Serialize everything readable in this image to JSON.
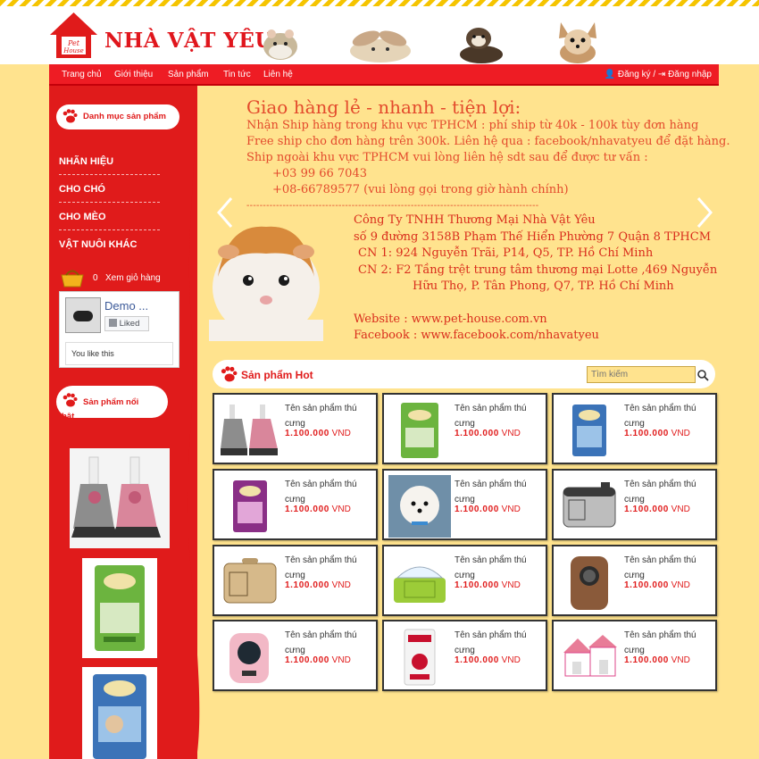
{
  "brand": {
    "logo_small_1": "Pet",
    "logo_small_2": "House",
    "name": "NHÀ VẬT YÊU"
  },
  "nav": {
    "items": [
      "Trang chủ",
      "Giới thiệu",
      "Sản phẩm",
      "Tin tức",
      "Liên hệ"
    ],
    "auth": "Đăng ký / ⇥ Đăng nhập"
  },
  "sidebar": {
    "category_title": "Danh mục sản phẩm",
    "menu": [
      "NHÃN HIỆU",
      "CHO CHÓ",
      "CHO MÈO",
      "VẬT NUÔI KHÁC"
    ],
    "cart_count": "0",
    "cart_label": "Xem giỏ hàng",
    "fb_name": "Demo ...",
    "fb_liked": "Liked",
    "fb_you_like": "You like this",
    "featured_title": "Sản phẩm nổi bật"
  },
  "notice": {
    "title": "Giao hàng lẻ - nhanh - tiện lợi:",
    "line1": "Nhận Ship hàng trong khu vực TPHCM : phí ship từ 40k - 100k tùy đơn hàng",
    "line2": "Free ship cho đơn hàng trên 300k. Liên hệ qua : facebook/nhavatyeu để đặt hàng.",
    "line3": "Ship ngoài khu vực TPHCM vui lòng liên hệ sdt sau để được tư vấn :",
    "phone1": "+03 99 66 7043",
    "phone2": "+08-66789577 (vui lòng gọi trong giờ hành chính)",
    "divider": "-----------------------------------------------------------------------------------------"
  },
  "company": {
    "name": "Công Ty TNHH Thương Mại Nhà Vật Yêu",
    "address": "số 9 đường 3158B Phạm Thế Hiển Phường 7 Quận 8 TPHCM",
    "branch1": "CN 1: 924 Nguyễn Trãi, P14, Q5, TP. Hồ Chí Minh",
    "branch2a": "CN 2: F2 Tầng trệt trung tâm thương mại Lotte ,469 Nguyễn",
    "branch2b": "Hữu Thọ, P. Tân Phong, Q7, TP. Hồ Chí Minh",
    "website": "Website : www.pet-house.com.vn",
    "facebook": "Facebook : www.facebook.com/nhavatyeu"
  },
  "hot": {
    "title": "Sản phẩm Hot",
    "search_placeholder": "Tìm kiếm"
  },
  "products": [
    {
      "name": "Tên sản phẩm thú cưng",
      "price": "1.100.000",
      "unit": "VND",
      "icon": "dress-icon"
    },
    {
      "name": "Tên sản phẩm thú cưng",
      "price": "1.100.000",
      "unit": "VND",
      "icon": "green-food-bag-icon"
    },
    {
      "name": "Tên sản phẩm thú cưng",
      "price": "1.100.000",
      "unit": "VND",
      "icon": "blue-food-bag-icon"
    },
    {
      "name": "Tên sản phẩm thú cưng",
      "price": "1.100.000",
      "unit": "VND",
      "icon": "purple-food-bag-icon"
    },
    {
      "name": "Tên sản phẩm thú cưng",
      "price": "1.100.000",
      "unit": "VND",
      "icon": "white-dog-icon"
    },
    {
      "name": "Tên sản phẩm thú cưng",
      "price": "1.100.000",
      "unit": "VND",
      "icon": "grey-carrier-icon"
    },
    {
      "name": "Tên sản phẩm thú cưng",
      "price": "1.100.000",
      "unit": "VND",
      "icon": "tan-carrier-icon"
    },
    {
      "name": "Tên sản phẩm thú cưng",
      "price": "1.100.000",
      "unit": "VND",
      "icon": "green-carrier-icon"
    },
    {
      "name": "Tên sản phẩm thú cưng",
      "price": "1.100.000",
      "unit": "VND",
      "icon": "brown-backpack-icon"
    },
    {
      "name": "Tên sản phẩm thú cưng",
      "price": "1.100.000",
      "unit": "VND",
      "icon": "pink-backpack-icon"
    },
    {
      "name": "Tên sản phẩm thú cưng",
      "price": "1.100.000",
      "unit": "VND",
      "icon": "cat-food-bag-icon"
    },
    {
      "name": "Tên sản phẩm thú cưng",
      "price": "1.100.000",
      "unit": "VND",
      "icon": "pink-pet-house-icon"
    }
  ],
  "colors": {
    "brand_red": "#e01b1b",
    "background": "#ffe38e",
    "notice_text": "#e34a2c"
  }
}
